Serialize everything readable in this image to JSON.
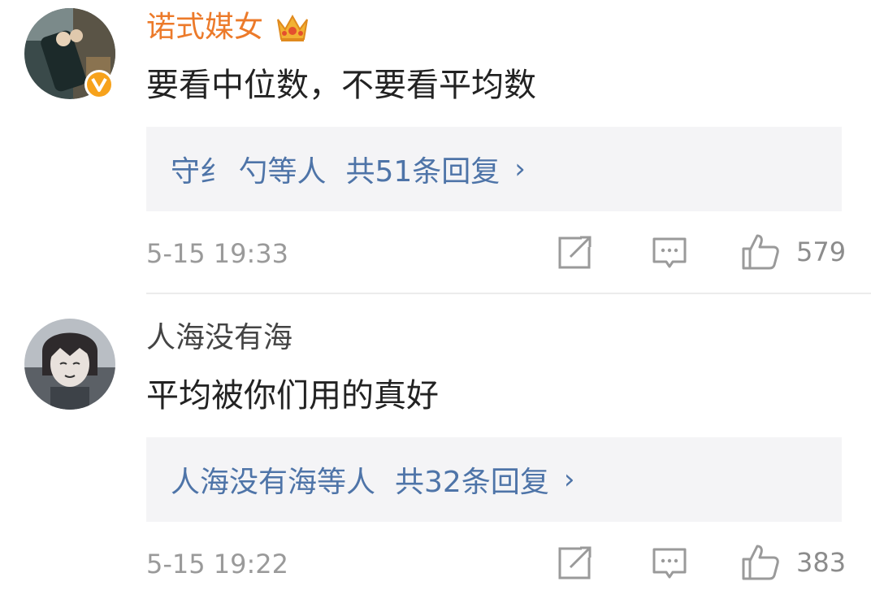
{
  "comments": [
    {
      "username": "诺式媒女",
      "is_vip": true,
      "verified": true,
      "text": "要看中位数，不要看平均数",
      "replies_names": "守纟 勺等人",
      "replies_count": "共51条回复",
      "time": "5-15 19:33",
      "likes": "579"
    },
    {
      "username": "人海没有海",
      "is_vip": false,
      "verified": false,
      "text": "平均被你们用的真好",
      "replies_names": "人海没有海等人",
      "replies_count": "共32条回复",
      "time": "5-15 19:22",
      "likes": "383"
    }
  ],
  "icons": {
    "reply_chevron": "›",
    "share": "share-icon",
    "comment": "comment-icon",
    "like": "thumbs-up-icon"
  },
  "colors": {
    "vip_name": "#ec7a2a",
    "link": "#4e74a8",
    "verified_badge": "#f7a21b"
  }
}
